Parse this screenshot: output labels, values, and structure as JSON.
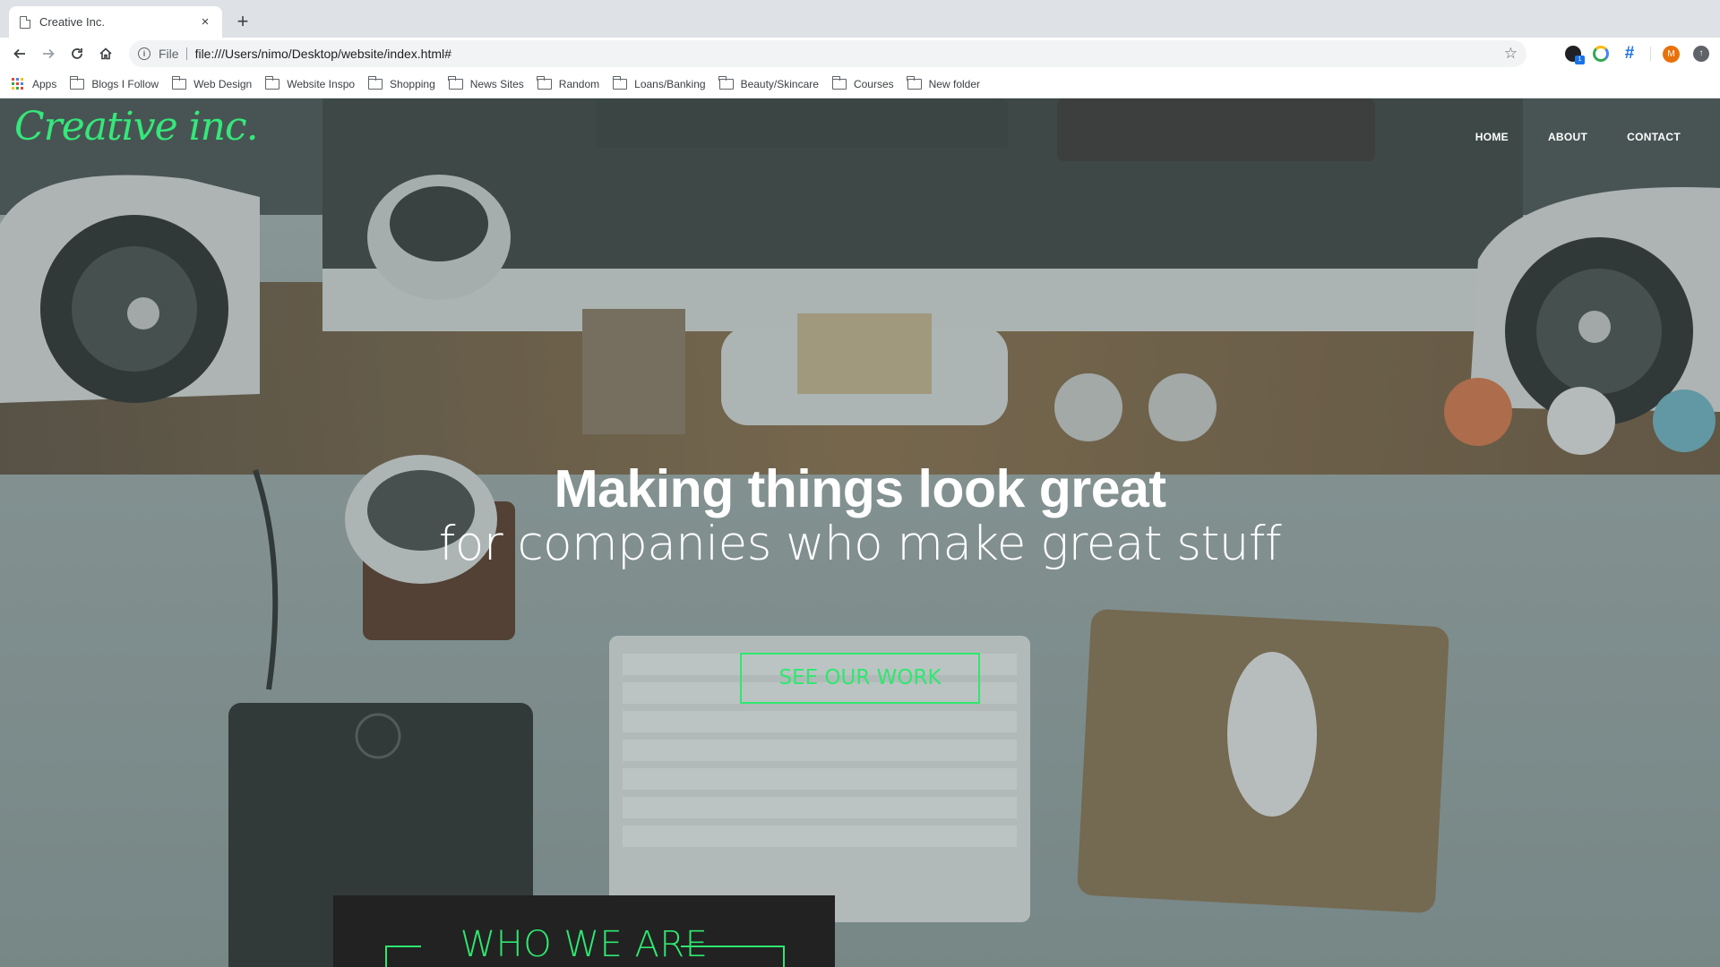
{
  "browser": {
    "tab_title": "Creative Inc.",
    "tab_close": "×",
    "new_tab": "+",
    "url_scheme": "File",
    "url": "file:///Users/nimo/Desktop/website/index.html#",
    "extension_badge": "1",
    "avatar_letter": "M",
    "bookmarks": [
      "Apps",
      "Blogs I Follow",
      "Web Design",
      "Website Inspo",
      "Shopping",
      "News Sites",
      "Random",
      "Loans/Banking",
      "Beauty/Skincare",
      "Courses",
      "New folder"
    ]
  },
  "site": {
    "logo": "Creative inc.",
    "nav": [
      "HOME",
      "ABOUT",
      "CONTACT"
    ],
    "headline": "Making things look great",
    "subline": "for companies who make great stuff",
    "cta": "SEE OUR WORK",
    "section_title": "WHO WE ARE"
  },
  "colors": {
    "accent": "#2ee86f",
    "nav_text": "#ffffff",
    "section_bg": "#222222"
  }
}
